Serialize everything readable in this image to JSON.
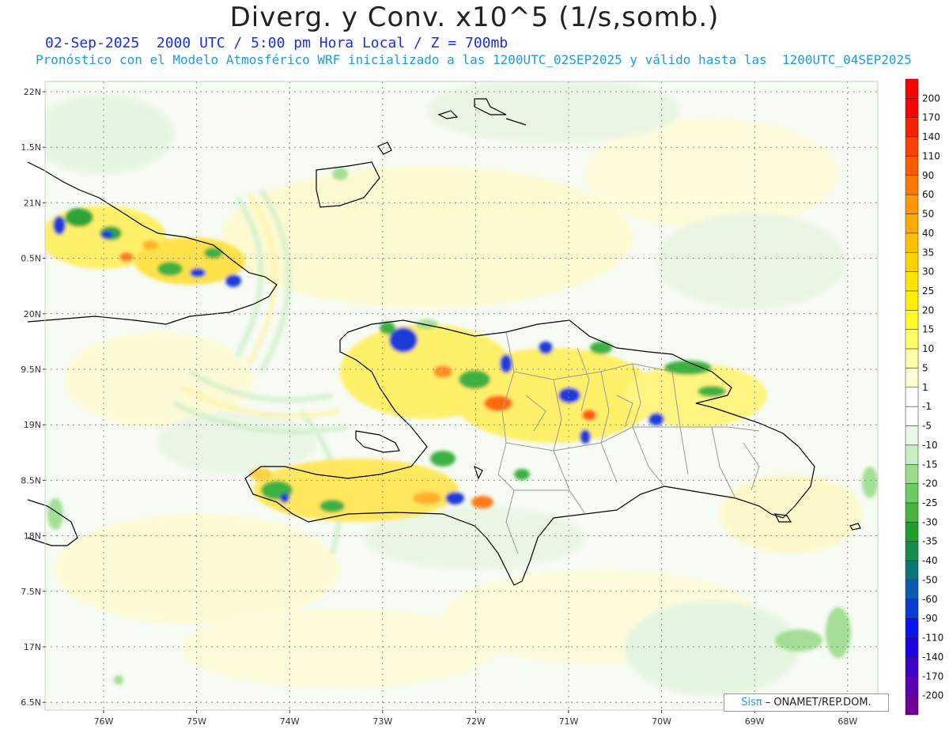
{
  "header": {
    "title": "Diverg. y Conv. x10^5 (1/s,somb.)",
    "subtitle": "02-Sep-2025  2000 UTC / 5:00 pm Hora Local / Z = 700mb",
    "model_info": "Pronóstico con el Modelo Atmosférico WRF inicializado a las 1200UTC_02SEP2025 y válido hasta las  1200UTC_04SEP2025"
  },
  "axes": {
    "lat_labels": [
      "22N",
      "1.5N",
      "21N",
      "0.5N",
      "20N",
      "9.5N",
      "19N",
      "8.5N",
      "18N",
      "7.5N",
      "17N",
      "6.5N"
    ],
    "lon_labels": [
      "76W",
      "75W",
      "74W",
      "73W",
      "72W",
      "71W",
      "70W",
      "69W",
      "68W"
    ]
  },
  "colorbar": {
    "labels": [
      "200",
      "170",
      "140",
      "110",
      "90",
      "60",
      "50",
      "40",
      "35",
      "30",
      "25",
      "20",
      "15",
      "10",
      "5",
      "1",
      "-1",
      "-5",
      "-10",
      "-15",
      "-20",
      "-25",
      "-30",
      "-35",
      "-40",
      "-50",
      "-60",
      "-90",
      "-110",
      "-140",
      "-170",
      "-200"
    ],
    "colors": [
      "#ff0000",
      "#ff2000",
      "#ff4000",
      "#ff5a00",
      "#ff7800",
      "#ff9600",
      "#ffaa00",
      "#ffc000",
      "#ffd200",
      "#ffe600",
      "#fff000",
      "#fffa28",
      "#ffff64",
      "#ffffaa",
      "#ffffd2",
      "#ffffff",
      "#ffffff",
      "#eaf7e6",
      "#c8edc2",
      "#9bdc8c",
      "#6ecb63",
      "#44b53c",
      "#1fa02d",
      "#148c50",
      "#0a7878",
      "#0a5ab4",
      "#0a3cd2",
      "#0a14f0",
      "#1e00e6",
      "#3c00c8",
      "#5a00b4",
      "#6e0096"
    ]
  },
  "credit": {
    "brand": "Sisπ",
    "organization": "– ONAMET/REP.DOM."
  },
  "colors": {
    "title": "#222222",
    "subtitle": "#1a2ee6",
    "model_info": "#1a9be6",
    "land_outline": "#000000",
    "province_lines": "#9a9a9a"
  }
}
